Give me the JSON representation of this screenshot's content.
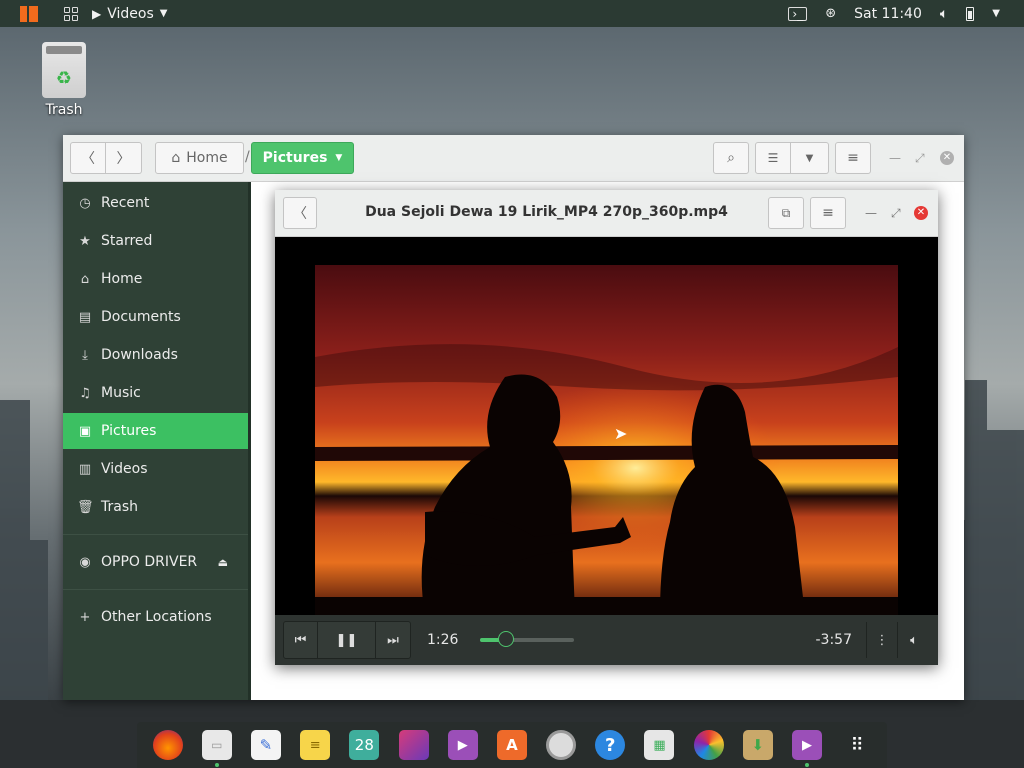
{
  "topbar": {
    "app_name": "Videos",
    "clock": "Sat 11:40"
  },
  "desktop": {
    "trash_label": "Trash"
  },
  "file_manager": {
    "breadcrumb_home": "Home",
    "breadcrumb_separator": "/",
    "breadcrumb_current": "Pictures",
    "sidebar": [
      {
        "label": "Recent",
        "icon": "clock-icon"
      },
      {
        "label": "Starred",
        "icon": "star-icon"
      },
      {
        "label": "Home",
        "icon": "home-icon"
      },
      {
        "label": "Documents",
        "icon": "document-icon"
      },
      {
        "label": "Downloads",
        "icon": "download-icon"
      },
      {
        "label": "Music",
        "icon": "music-icon"
      },
      {
        "label": "Pictures",
        "icon": "picture-icon",
        "active": true
      },
      {
        "label": "Videos",
        "icon": "film-icon"
      },
      {
        "label": "Trash",
        "icon": "trash-icon"
      }
    ],
    "device": {
      "label": "OPPO DRIVER",
      "icon": "disc-icon"
    },
    "other_locations": {
      "label": "Other Locations",
      "icon": "plus-icon"
    }
  },
  "video_window": {
    "title": "Dua Sejoli Dewa 19 Lirik_MP4 270p_360p.mp4",
    "elapsed": "1:26",
    "remaining": "-3:57",
    "progress": 0.27
  },
  "colors": {
    "accent": "#4ec46d",
    "sidebar_bg": "#2f4136",
    "topbar_bg": "#2b3a33",
    "close_red": "#e53935"
  },
  "dock": {
    "calendar_day": "28",
    "help_glyph": "?"
  }
}
